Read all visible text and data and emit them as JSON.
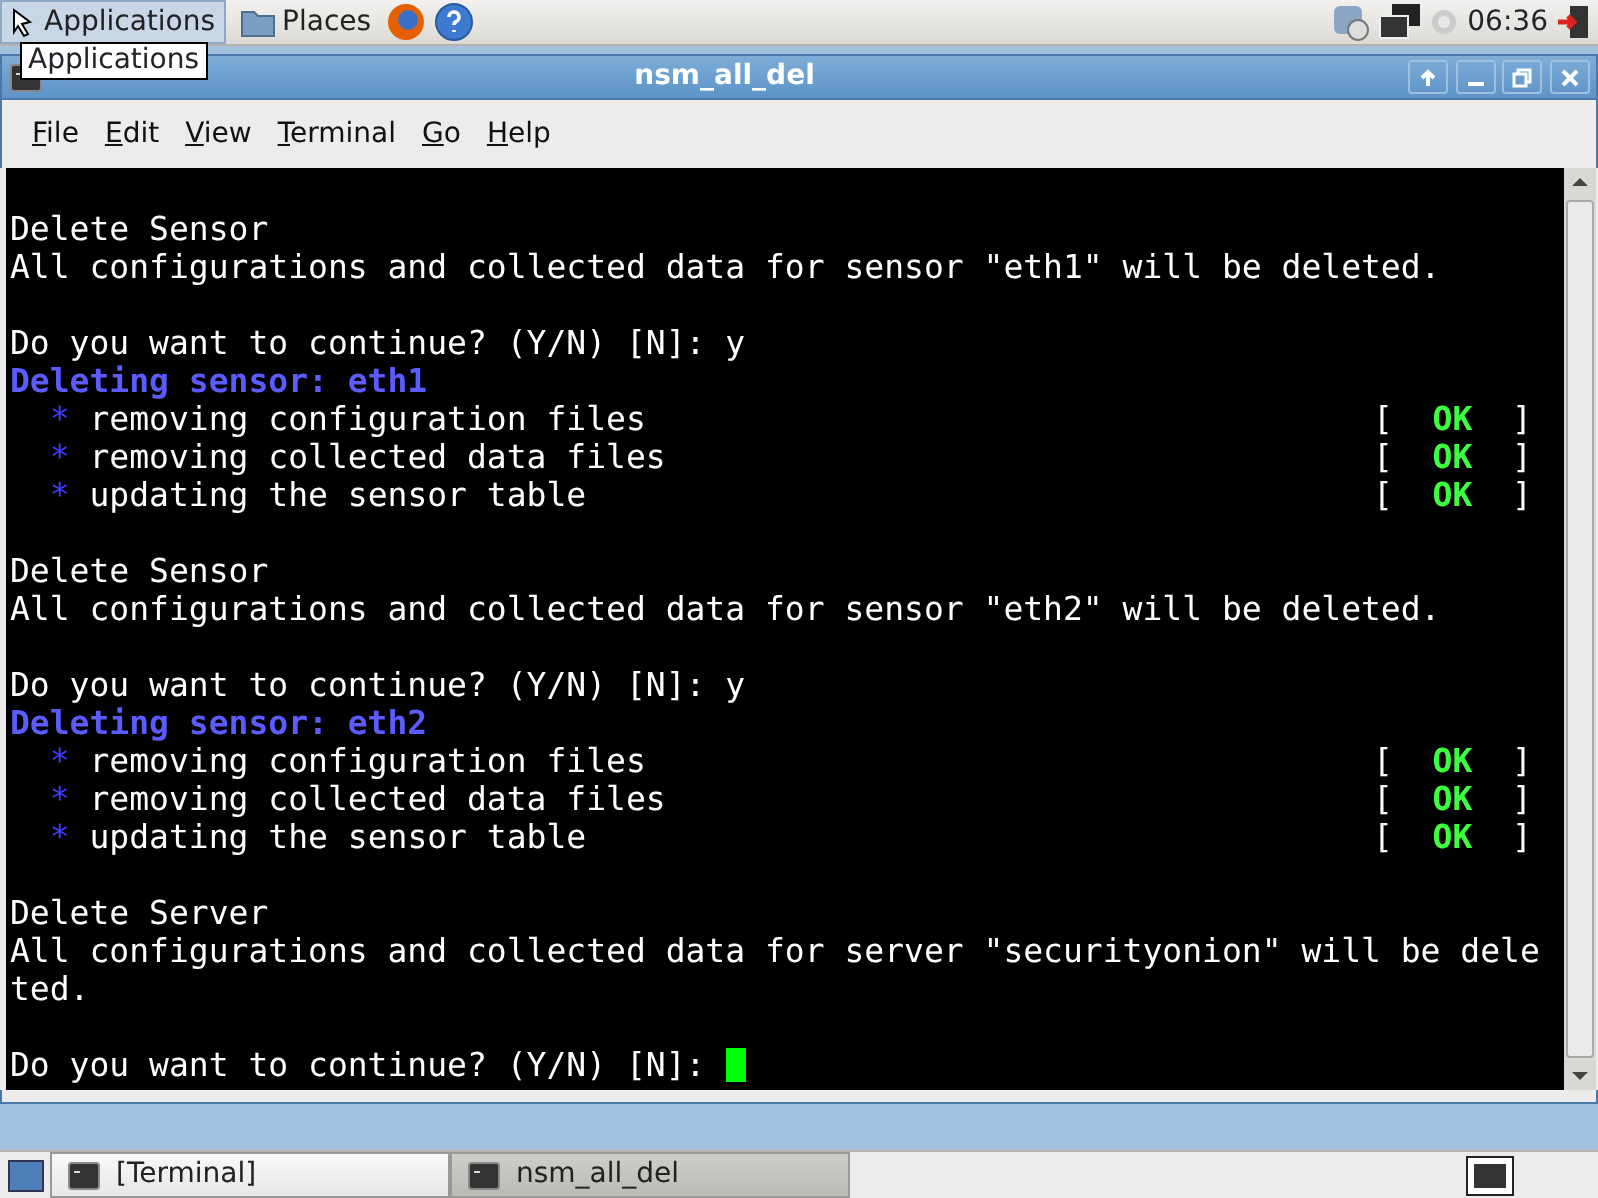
{
  "top_panel": {
    "menus": [
      "Applications",
      "Places"
    ],
    "clock": "06:36",
    "tooltip": "Applications"
  },
  "window": {
    "title": "nsm_all_del"
  },
  "menu_bar": [
    "File",
    "Edit",
    "View",
    "Terminal",
    "Go",
    "Help"
  ],
  "terminal": {
    "lines": [
      {
        "kind": "blank"
      },
      {
        "kind": "plain",
        "text": "Delete Sensor"
      },
      {
        "kind": "plain",
        "text": "All configurations and collected data for sensor \"eth1\" will be deleted."
      },
      {
        "kind": "blank"
      },
      {
        "kind": "plain",
        "text": "Do you want to continue? (Y/N) [N]: y"
      },
      {
        "kind": "heading",
        "text": "Deleting sensor: eth1"
      },
      {
        "kind": "step",
        "bullet": "*",
        "text": "removing configuration files",
        "open": "[",
        "status": "OK",
        "close": "]"
      },
      {
        "kind": "step",
        "bullet": "*",
        "text": "removing collected data files",
        "open": "[",
        "status": "OK",
        "close": "]"
      },
      {
        "kind": "step",
        "bullet": "*",
        "text": "updating the sensor table",
        "open": "[",
        "status": "OK",
        "close": "]"
      },
      {
        "kind": "blank"
      },
      {
        "kind": "plain",
        "text": "Delete Sensor"
      },
      {
        "kind": "plain",
        "text": "All configurations and collected data for sensor \"eth2\" will be deleted."
      },
      {
        "kind": "blank"
      },
      {
        "kind": "plain",
        "text": "Do you want to continue? (Y/N) [N]: y"
      },
      {
        "kind": "heading",
        "text": "Deleting sensor: eth2"
      },
      {
        "kind": "step",
        "bullet": "*",
        "text": "removing configuration files",
        "open": "[",
        "status": "OK",
        "close": "]"
      },
      {
        "kind": "step",
        "bullet": "*",
        "text": "removing collected data files",
        "open": "[",
        "status": "OK",
        "close": "]"
      },
      {
        "kind": "step",
        "bullet": "*",
        "text": "updating the sensor table",
        "open": "[",
        "status": "OK",
        "close": "]"
      },
      {
        "kind": "blank"
      },
      {
        "kind": "plain",
        "text": "Delete Server"
      },
      {
        "kind": "plain",
        "text": "All configurations and collected data for server \"securityonion\" will be dele"
      },
      {
        "kind": "plain",
        "text": "ted."
      },
      {
        "kind": "blank"
      },
      {
        "kind": "prompt",
        "text": "Do you want to continue? (Y/N) [N]: "
      }
    ]
  },
  "taskbar": [
    {
      "label": "[Terminal]",
      "selected": false
    },
    {
      "label": "nsm_all_del",
      "selected": true
    }
  ]
}
